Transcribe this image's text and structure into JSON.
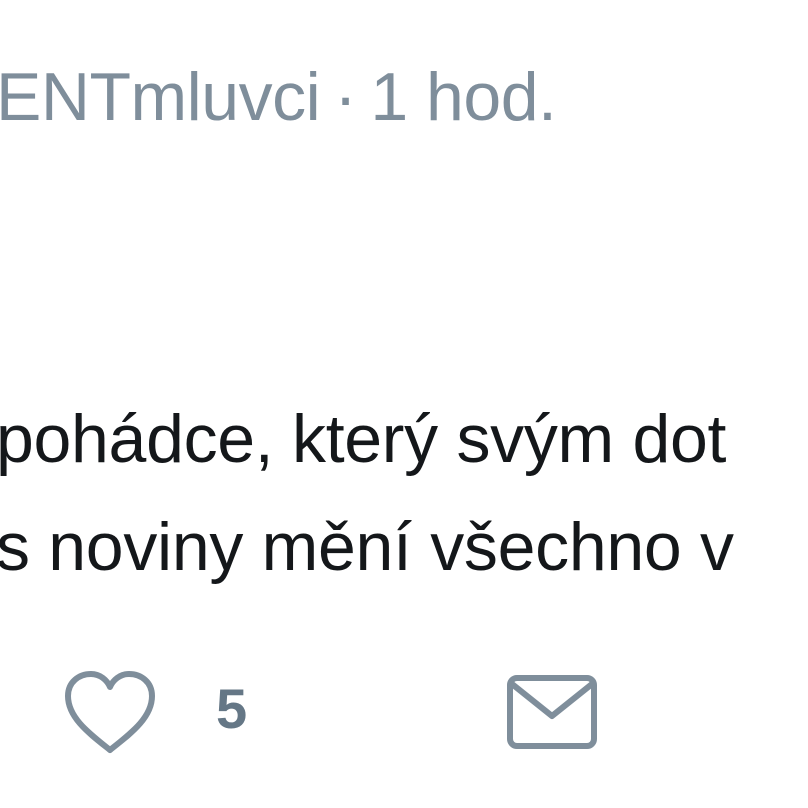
{
  "header": {
    "handle": "ENTmluvci",
    "separator": "·",
    "time": "1 hod."
  },
  "body": {
    "lines": [
      "pohádce, který svým dot",
      "s noviny mění všechno v"
    ]
  },
  "actions": {
    "like_icon": "heart-outline-icon",
    "like_count": "5",
    "message_icon": "envelope-icon"
  },
  "colors": {
    "meta_text": "#7f8e9b",
    "body_text": "#14171a",
    "icon_stroke": "#7f8e9b",
    "count_text": "#657786"
  }
}
